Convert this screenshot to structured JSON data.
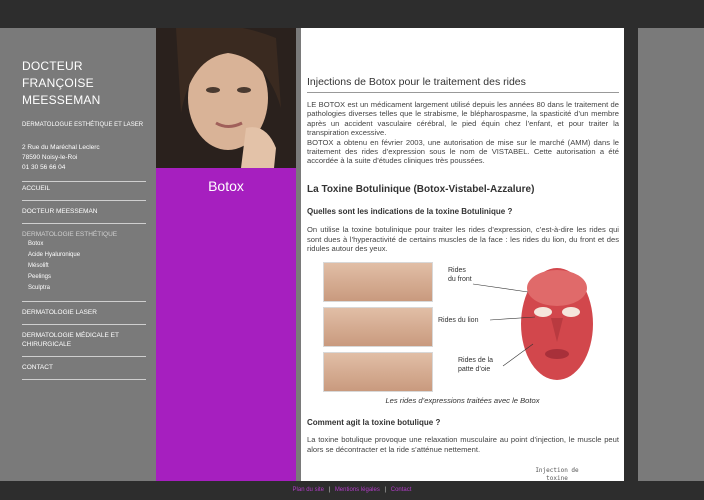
{
  "sidebar": {
    "doctor_name_line1": "DOCTEUR FRANÇOISE",
    "doctor_name_line2": "MEESSEMAN",
    "specialty": "DERMATOLOGUE ESTHÉTIQUE ET LASER",
    "address_line1": "2 Rue du Maréchal Leclerc",
    "address_line2": "78590 Noisy-le-Roi",
    "phone": "01 30 56 66 04"
  },
  "menu": {
    "accueil": "ACCUEIL",
    "docteur": "DOCTEUR MEESSEMAN",
    "dermato_esthetique": "DERMATOLOGIE ESTHÉTIQUE",
    "sub": [
      "Botox",
      "Acide Hyaluronique",
      "Mésolift",
      "Peelings",
      "Sculptra"
    ],
    "laser": "DERMATOLOGIE LASER",
    "medicale_line1": "DERMATOLOGIE MÉDICALE ET",
    "medicale_line2": "CHIRURGICALE",
    "contact": "CONTACT"
  },
  "banner": {
    "title": "Botox"
  },
  "content": {
    "title": "Injections de Botox pour le traitement des rides",
    "intro": "LE BOTOX est un médicament largement utilisé depuis les années 80 dans le traitement de pathologies diverses telles que le strabisme, le blépharospasme, la spasticité d’un membre après un accident vasculaire cérébral, le pied équin chez l’enfant, et pour traiter la transpiration excessive.",
    "intro2": "BOTOX a obtenu en février 2003, une autorisation de mise sur le marché (AMM) dans le traitement des rides d’expression sous le nom  de VISTABEL. Cette autorisation a été accordée à la suite d’études cliniques très poussées.",
    "heading": "La Toxine Botulinique (Botox-Vistabel-Azzalure)",
    "q1": "Quelles sont les indications de la toxine Botulinique ?",
    "a1": "On utilise la toxine botulinique pour traiter les rides d’expression, c’est-à-dire  les rides qui sont dues à l’hyperactivité de certains muscles de la face : les rides du lion, du front  et des ridules autour des yeux.",
    "fig_label1_a": "Rides",
    "fig_label1_b": "du front",
    "fig_label2": "Rides du lion",
    "fig_label3_a": "Rides de la",
    "fig_label3_b": "patte d’oie",
    "caption": "Les rides d’expressions traitées avec le Botox",
    "q2": "Comment agit la toxine botulique ?",
    "a2": "La toxine botulique provoque une relaxation musculaire au point d’injection, le muscle peut alors se décontracter et la ride s’atténue nettement.",
    "mono_line1": "Injection de",
    "mono_line2": "toxine"
  },
  "footer": {
    "link1": "Plan du site",
    "link2": "Mentions légales",
    "link3": "Contact",
    "separator": "|"
  },
  "colors": {
    "accent": "#a61fbf",
    "sidebar_bg": "#7a7a7a",
    "frame_bg": "#2d2d2d"
  }
}
